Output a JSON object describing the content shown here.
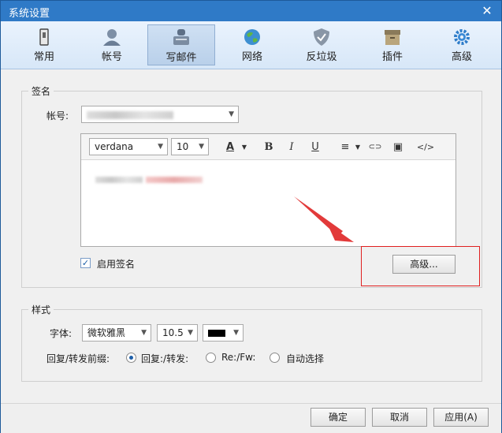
{
  "window": {
    "title": "系统设置",
    "close_glyph": "✕"
  },
  "tabs": [
    {
      "label": "常用",
      "icon": "phone-icon"
    },
    {
      "label": "帐号",
      "icon": "user-icon"
    },
    {
      "label": "写邮件",
      "icon": "compose-icon"
    },
    {
      "label": "网络",
      "icon": "globe-icon"
    },
    {
      "label": "反垃圾",
      "icon": "shield-icon"
    },
    {
      "label": "插件",
      "icon": "box-icon"
    },
    {
      "label": "高级",
      "icon": "gear-icon"
    }
  ],
  "active_tab": "写邮件",
  "signature": {
    "group_title": "签名",
    "account_label": "帐号:",
    "editor": {
      "font_value": "verdana",
      "size_value": "10",
      "font_color_glyph": "A",
      "bold_glyph": "B",
      "italic_glyph": "I",
      "underline_glyph": "U",
      "align_glyph": "≡",
      "link_glyph": "⊂⊃",
      "image_glyph": "▣",
      "code_glyph": "</>"
    },
    "enable_label": "启用签名",
    "enable_checked": true,
    "advanced_button": "高级..."
  },
  "style": {
    "group_title": "样式",
    "font_label": "字体:",
    "font_value": "微软雅黑",
    "size_value": "10.5",
    "color_value": "#000000",
    "prefix_label": "回复/转发前缀:",
    "options": [
      "回复:/转发:",
      "Re:/Fw:",
      "自动选择"
    ],
    "selected_option": "回复:/转发:"
  },
  "footer": {
    "ok": "确定",
    "cancel": "取消",
    "apply": "应用(A)"
  },
  "colors": {
    "titlebar": "#2f7ac7",
    "highlight": "#e02020",
    "arrow": "#e23a3a"
  }
}
